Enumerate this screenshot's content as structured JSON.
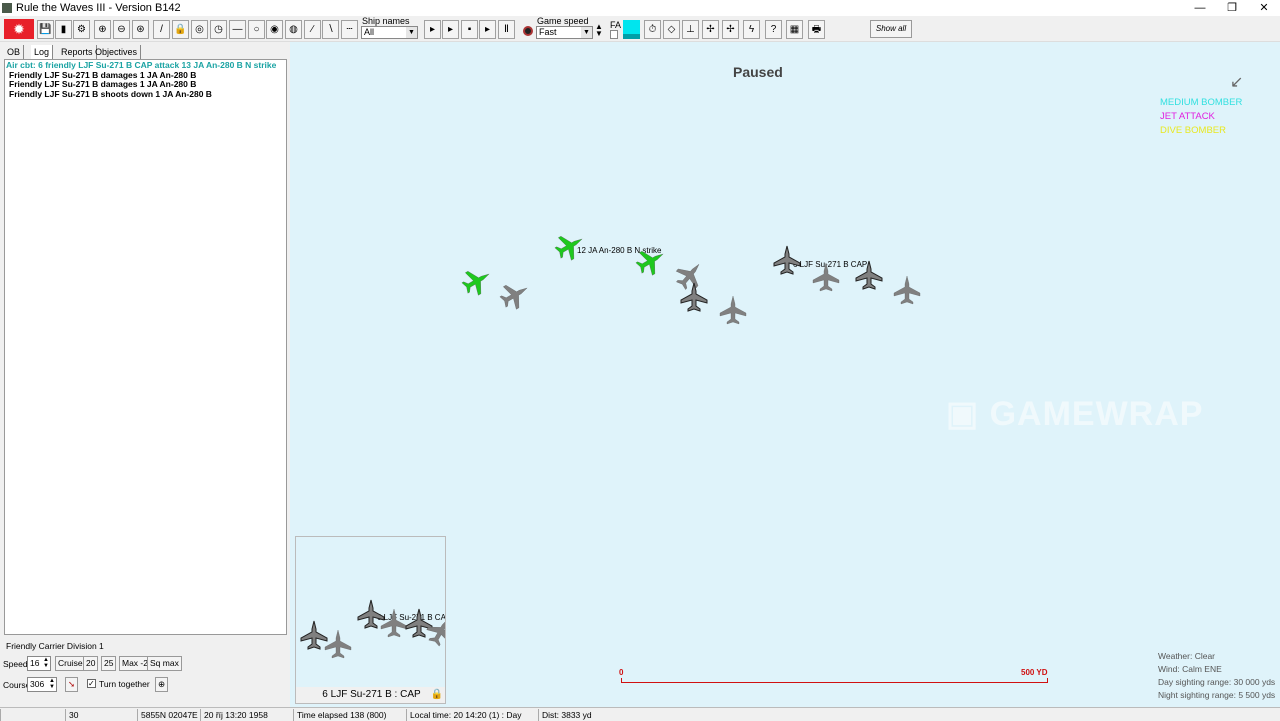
{
  "window": {
    "title": "Rule the Waves III - Version B142",
    "minimize": "—",
    "restore": "❐",
    "close": "✕"
  },
  "toolbar": {
    "ship_names_label": "Ship names",
    "ship_names_value": "All",
    "game_speed_label": "Game speed",
    "game_speed_value": "Fast",
    "fa_label": "FA",
    "show_all": "Show all"
  },
  "tabs": [
    "OB",
    "Log",
    "Reports",
    "Objectives"
  ],
  "log": {
    "header": "Air cbt: 6  friendly LJF Su-271 B CAP attack 13 JA An-280 B N strike",
    "header_color": "#1aa3a3",
    "lines": [
      "Friendly LJF Su-271 B damages 1 JA An-280 B",
      "Friendly LJF Su-271 B damages 1 JA An-280 B",
      "Friendly LJF Su-271 B shoots down 1 JA An-280 B"
    ]
  },
  "division": {
    "name": "Friendly Carrier Division 1",
    "speed_label": "Speed",
    "speed_value": "16",
    "speed_buttons": [
      "Cruise",
      "20",
      "25",
      "Max -2",
      "Sq max"
    ],
    "course_label": "Course",
    "course_value": "306",
    "turn_together": "Turn together",
    "turn_together_checked": true
  },
  "map": {
    "status": "Paused",
    "legend": [
      {
        "label": "MEDIUM BOMBER",
        "color": "#33e0e0"
      },
      {
        "label": "JET ATTACK",
        "color": "#e020e0"
      },
      {
        "label": "DIVE BOMBER",
        "color": "#e8e820"
      }
    ],
    "enemy_label": "12 JA An-280 B N strike",
    "friendly_label": "6 LJF Su-271 B CAP",
    "scale_start": "0",
    "scale_end": "500 YD",
    "watermark": "GAMEWRAP"
  },
  "inset": {
    "label": "6 LJF Su-271 B CAP",
    "caption": "6 LJF Su-271 B : CAP"
  },
  "weather": {
    "weather": "Weather: Clear",
    "wind": "Wind: Calm  ENE",
    "day": "Day sighting range: 30 000 yds",
    "night": "Night sighting range: 5 500 yds"
  },
  "statusbar": [
    "",
    "30",
    "5855N 02047E",
    "20 říj 13:20 1958",
    "Time elapsed 138 (800)",
    "Local time: 20 14:20 (1) : Day",
    "Dist: 3833 yd"
  ]
}
